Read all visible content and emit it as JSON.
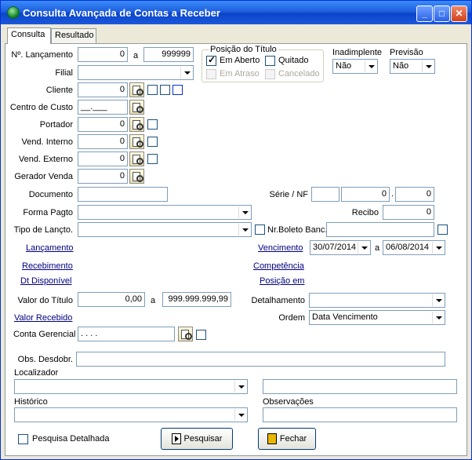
{
  "window": {
    "title": "Consulta Avançada de Contas a Receber"
  },
  "tabs": [
    {
      "label": "Consulta"
    },
    {
      "label": "Resultado"
    }
  ],
  "form": {
    "lancamento_label": "Nº. Lançamento",
    "lancamento_from": "0",
    "a_label": "a",
    "lancamento_to": "999999",
    "filial_label": "Filial",
    "cliente_label": "Cliente",
    "cliente_value": "0",
    "centro_custo_label": "Centro de Custo",
    "centro_custo_value": "__.___",
    "portador_label": "Portador",
    "portador_value": "0",
    "vend_interno_label": "Vend. Interno",
    "vend_interno_value": "0",
    "vend_externo_label": "Vend. Externo",
    "vend_externo_value": "0",
    "gerador_venda_label": "Gerador Venda",
    "gerador_venda_value": "0",
    "documento_label": "Documento",
    "serie_nf_label": "Série / NF",
    "nf_value": "0",
    "nf_dot": ".",
    "nf_value2": "0",
    "forma_pagto_label": "Forma Pagto",
    "recibo_label": "Recibo",
    "recibo_value": "0",
    "tipo_lancto_label": "Tipo de Lançto.",
    "nr_boleto_label": "Nr.Boleto Banc.",
    "lancamento_link": "Lançamento",
    "recebimento_link": "Recebimento",
    "dt_disponivel_link": "Dt Disponível",
    "vencimento_link": "Vencimento",
    "venc_from": "30/07/2014",
    "venc_a": "a",
    "venc_to": "06/08/2014",
    "competencia_link": "Competência",
    "posicao_em_link": "Posição em",
    "valor_titulo_label": "Valor do Título",
    "valor_from": "0,00",
    "valor_a": "a",
    "valor_to": "999.999.999,99",
    "detalhamento_label": "Detalhamento",
    "valor_recebido_link": "Valor Recebido",
    "ordem_label": "Ordem",
    "ordem_value": "Data Vencimento",
    "conta_gerencial_label": "Conta Gerencial",
    "conta_gerencial_value": ". . . .",
    "obs_desdobr_label": "Obs. Desdobr.",
    "localizador_label": "Localizador",
    "historico_label": "Histórico",
    "observacoes_label": "Observações"
  },
  "posicao": {
    "legend": "Posição do Título",
    "em_aberto": "Em Aberto",
    "quitado": "Quitado",
    "em_atraso": "Em Atraso",
    "cancelado": "Cancelado"
  },
  "inadimplente": {
    "label": "Inadimplente",
    "value": "Não"
  },
  "previsao": {
    "label": "Previsão",
    "value": "Não"
  },
  "footer": {
    "pesquisa_detalhada": "Pesquisa Detalhada",
    "pesquisar": "Pesquisar",
    "fechar": "Fechar"
  }
}
